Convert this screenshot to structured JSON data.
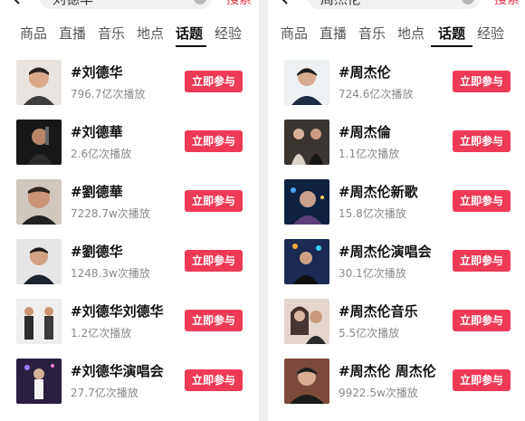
{
  "left": {
    "search": {
      "query": "刘德华",
      "button": "搜索"
    },
    "tabs": [
      {
        "label": "商品",
        "active": false
      },
      {
        "label": "直播",
        "active": false
      },
      {
        "label": "音乐",
        "active": false
      },
      {
        "label": "地点",
        "active": false
      },
      {
        "label": "话题",
        "active": true
      },
      {
        "label": "经验",
        "active": false
      }
    ],
    "items": [
      {
        "topic": "#刘德华",
        "plays": "796.7亿次播放",
        "join": "立即参与"
      },
      {
        "topic": "#刘德華",
        "plays": "2.6亿次播放",
        "join": "立即参与"
      },
      {
        "topic": "#劉德華",
        "plays": "7228.7w次播放",
        "join": "立即参与"
      },
      {
        "topic": "#劉德华",
        "plays": "1248.3w次播放",
        "join": "立即参与"
      },
      {
        "topic": "#刘德华刘德华",
        "plays": "1.2亿次播放",
        "join": "立即参与"
      },
      {
        "topic": "#刘德华演唱会",
        "plays": "27.7亿次播放",
        "join": "立即参与"
      }
    ]
  },
  "right": {
    "search": {
      "query": "周杰伦",
      "button": "搜索"
    },
    "tabs": [
      {
        "label": "商品",
        "active": false
      },
      {
        "label": "直播",
        "active": false
      },
      {
        "label": "音乐",
        "active": false
      },
      {
        "label": "地点",
        "active": false
      },
      {
        "label": "话题",
        "active": true
      },
      {
        "label": "经验",
        "active": false
      }
    ],
    "items": [
      {
        "topic": "#周杰伦",
        "plays": "724.6亿次播放",
        "join": "立即参与"
      },
      {
        "topic": "#周杰倫",
        "plays": "1.1亿次播放",
        "join": "立即参与"
      },
      {
        "topic": "#周杰伦新歌",
        "plays": "15.8亿次播放",
        "join": "立即参与"
      },
      {
        "topic": "#周杰伦演唱会",
        "plays": "30.1亿次播放",
        "join": "立即参与"
      },
      {
        "topic": "#周杰伦音乐",
        "plays": "5.5亿次播放",
        "join": "立即参与"
      },
      {
        "topic": "#周杰伦 周杰伦",
        "plays": "9922.5w次播放",
        "join": "立即参与"
      }
    ]
  },
  "colors": {
    "accent": "#ef3a55",
    "search_text": "#e8334a",
    "active_tab": "#111111"
  },
  "icons": {
    "back": "chevron-left-icon",
    "clear": "clear-icon"
  }
}
